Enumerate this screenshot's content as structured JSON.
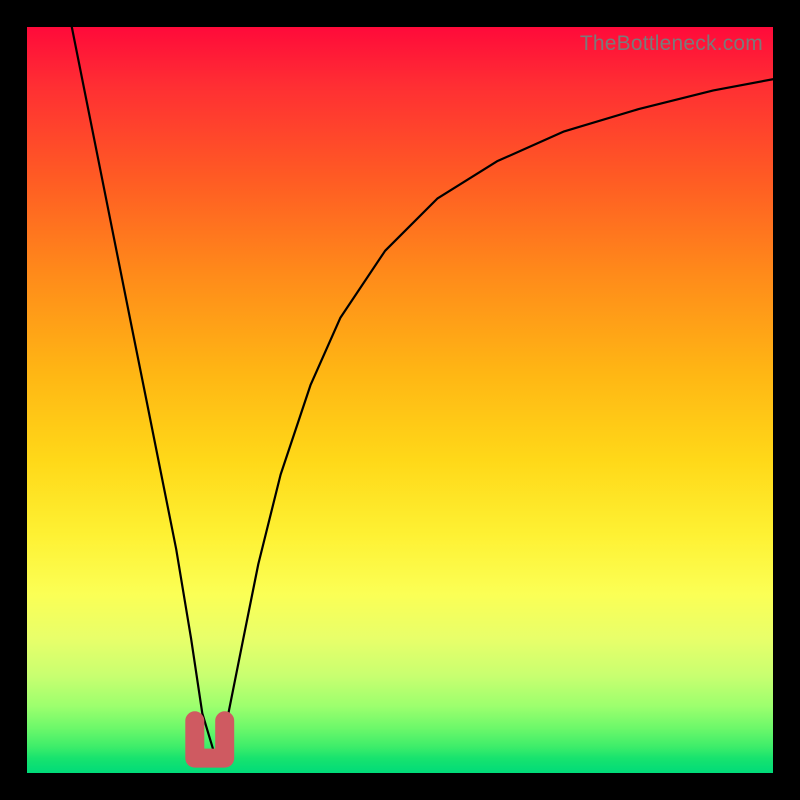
{
  "watermark": "TheBottleneck.com",
  "colors": {
    "frame": "#000000",
    "curve": "#000000",
    "marker": "#cf5a61",
    "gradient_top": "#ff0a3a",
    "gradient_bottom": "#00db79"
  },
  "chart_data": {
    "type": "line",
    "title": "",
    "xlabel": "",
    "ylabel": "",
    "xlim": [
      0,
      100
    ],
    "ylim": [
      0,
      100
    ],
    "note": "Axes are unlabeled; x and y are normalized 0–100 estimated from pixel positions. y=0 at bottom (green), y=100 at top (red).",
    "series": [
      {
        "name": "bottleneck-curve",
        "x": [
          6,
          8,
          10,
          12,
          14,
          16,
          18,
          20,
          22,
          23.5,
          25,
          26,
          27,
          29,
          31,
          34,
          38,
          42,
          48,
          55,
          63,
          72,
          82,
          92,
          100
        ],
        "y": [
          100,
          90,
          80,
          70,
          60,
          50,
          40,
          30,
          18,
          8,
          3,
          3,
          8,
          18,
          28,
          40,
          52,
          61,
          70,
          77,
          82,
          86,
          89,
          91.5,
          93
        ]
      }
    ],
    "annotations": [
      {
        "name": "optimal-marker",
        "shape": "u",
        "x_range": [
          22.5,
          26.5
        ],
        "y_range": [
          2,
          7
        ],
        "color": "#cf5a61"
      }
    ]
  }
}
